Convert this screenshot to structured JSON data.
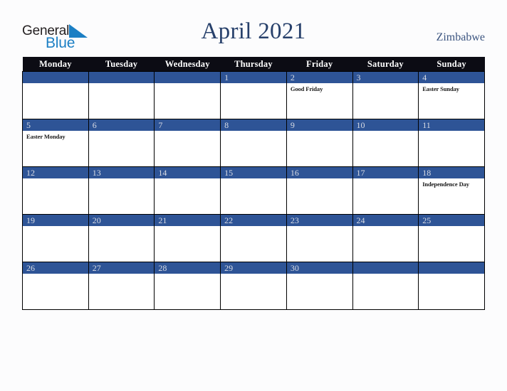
{
  "brand": {
    "name_part1": "General",
    "name_part2": "Blue",
    "triangle_color": "#1b7fc4",
    "text_color": "#231f20"
  },
  "header": {
    "title": "April 2021",
    "country": "Zimbabwe",
    "title_color": "#27406b",
    "country_color": "#3c5580"
  },
  "calendar": {
    "month": "April",
    "year": "2021",
    "weekday_headers": [
      "Monday",
      "Tuesday",
      "Wednesday",
      "Thursday",
      "Friday",
      "Saturday",
      "Sunday"
    ],
    "header_bg": "#0c0c14",
    "daynum_bg": "#2e5496",
    "daynum_color": "#d9dce4",
    "cell_bg": "#ffffff",
    "border_color": "#000000",
    "weeks": [
      [
        {
          "day": "",
          "holiday": ""
        },
        {
          "day": "",
          "holiday": ""
        },
        {
          "day": "",
          "holiday": ""
        },
        {
          "day": "1",
          "holiday": ""
        },
        {
          "day": "2",
          "holiday": "Good Friday"
        },
        {
          "day": "3",
          "holiday": ""
        },
        {
          "day": "4",
          "holiday": "Easter Sunday"
        }
      ],
      [
        {
          "day": "5",
          "holiday": "Easter Monday"
        },
        {
          "day": "6",
          "holiday": ""
        },
        {
          "day": "7",
          "holiday": ""
        },
        {
          "day": "8",
          "holiday": ""
        },
        {
          "day": "9",
          "holiday": ""
        },
        {
          "day": "10",
          "holiday": ""
        },
        {
          "day": "11",
          "holiday": ""
        }
      ],
      [
        {
          "day": "12",
          "holiday": ""
        },
        {
          "day": "13",
          "holiday": ""
        },
        {
          "day": "14",
          "holiday": ""
        },
        {
          "day": "15",
          "holiday": ""
        },
        {
          "day": "16",
          "holiday": ""
        },
        {
          "day": "17",
          "holiday": ""
        },
        {
          "day": "18",
          "holiday": "Independence Day"
        }
      ],
      [
        {
          "day": "19",
          "holiday": ""
        },
        {
          "day": "20",
          "holiday": ""
        },
        {
          "day": "21",
          "holiday": ""
        },
        {
          "day": "22",
          "holiday": ""
        },
        {
          "day": "23",
          "holiday": ""
        },
        {
          "day": "24",
          "holiday": ""
        },
        {
          "day": "25",
          "holiday": ""
        }
      ],
      [
        {
          "day": "26",
          "holiday": ""
        },
        {
          "day": "27",
          "holiday": ""
        },
        {
          "day": "28",
          "holiday": ""
        },
        {
          "day": "29",
          "holiday": ""
        },
        {
          "day": "30",
          "holiday": ""
        },
        {
          "day": "",
          "holiday": ""
        },
        {
          "day": "",
          "holiday": ""
        }
      ]
    ]
  }
}
